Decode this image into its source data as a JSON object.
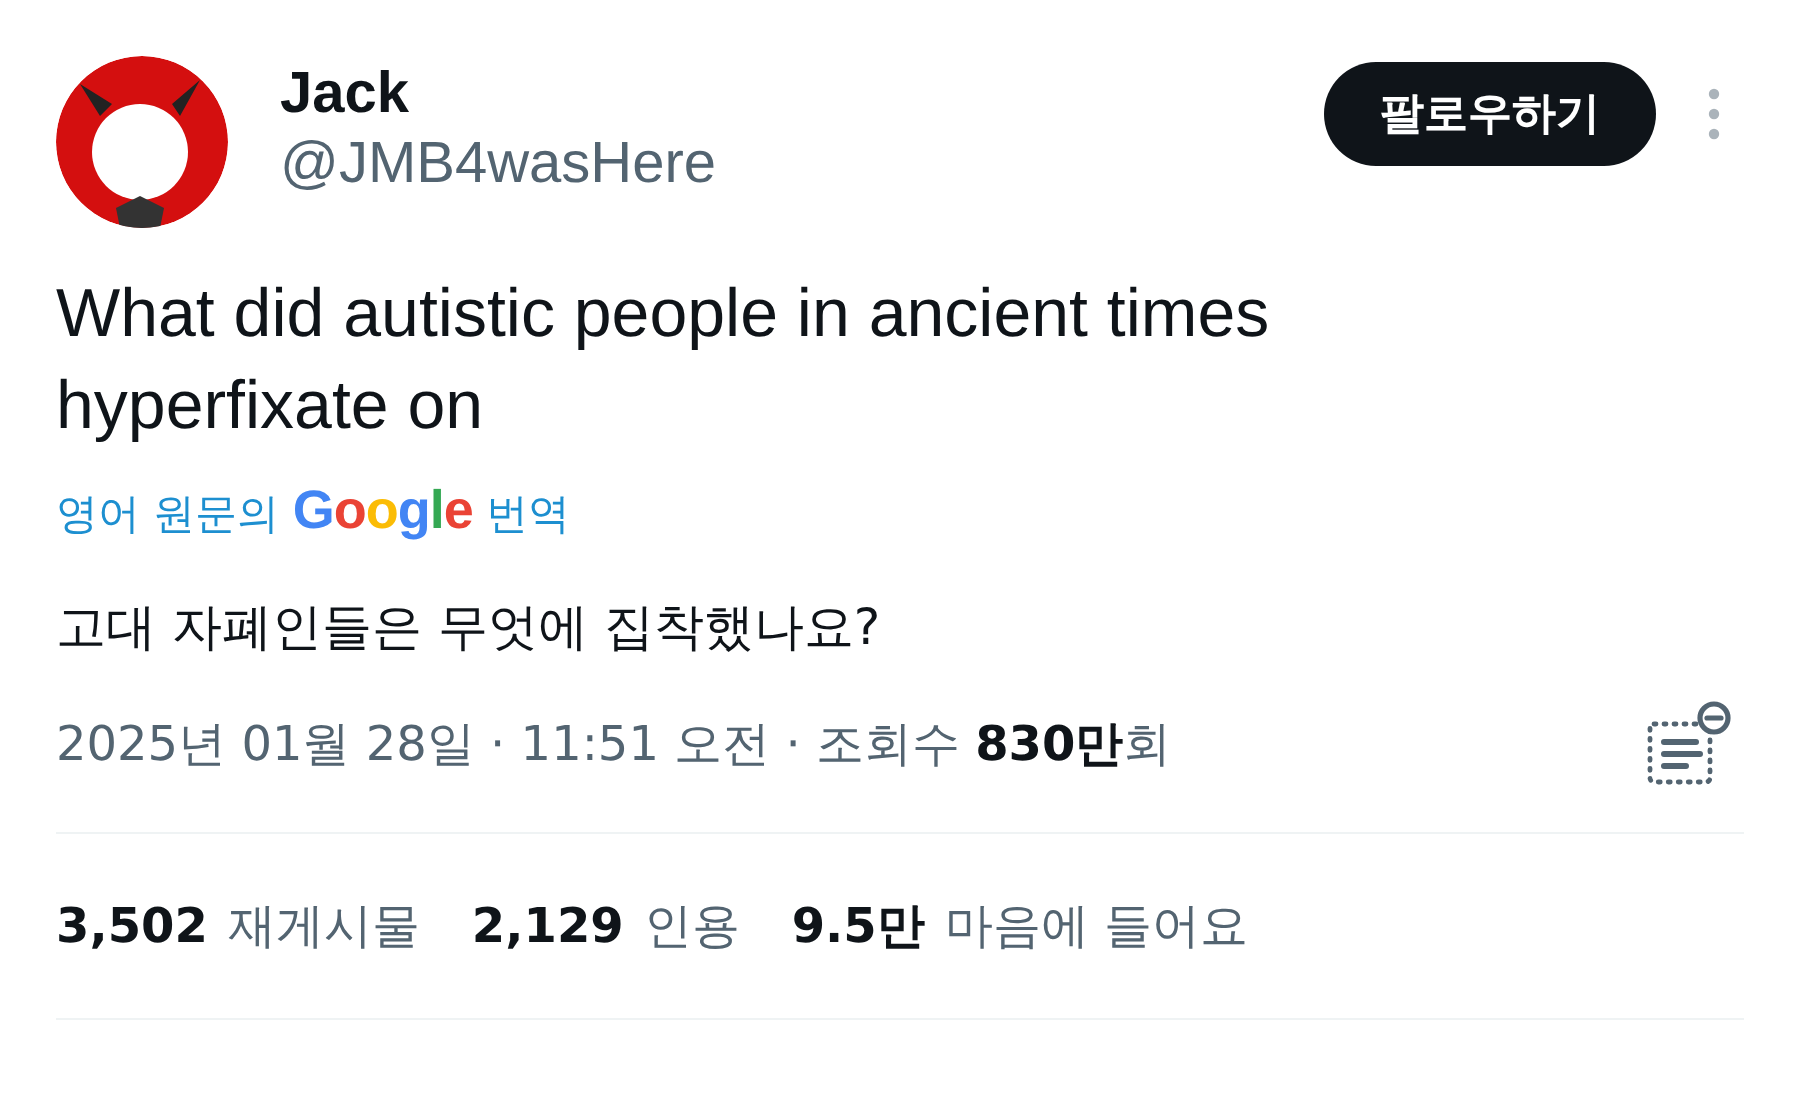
{
  "author": {
    "name": "Jack",
    "handle": "@JMB4wasHere"
  },
  "follow_button": "팔로우하기",
  "text": "What did autistic people in ancient times hyperfixate on",
  "translation_link": {
    "before": "영어 원문의",
    "brand": "Google",
    "after": "번역"
  },
  "translated_text": "고대 자폐인들은 무엇에 집착했나요?",
  "meta": "2025년 01월 28일 · 11:51 오전 · 조회수 **830만**회",
  "stats": [
    {
      "count": "3,502",
      "label": "재게시물"
    },
    {
      "count": "2,129",
      "label": "인용"
    },
    {
      "count": "9.5만",
      "label": "마음에 들어요"
    }
  ]
}
